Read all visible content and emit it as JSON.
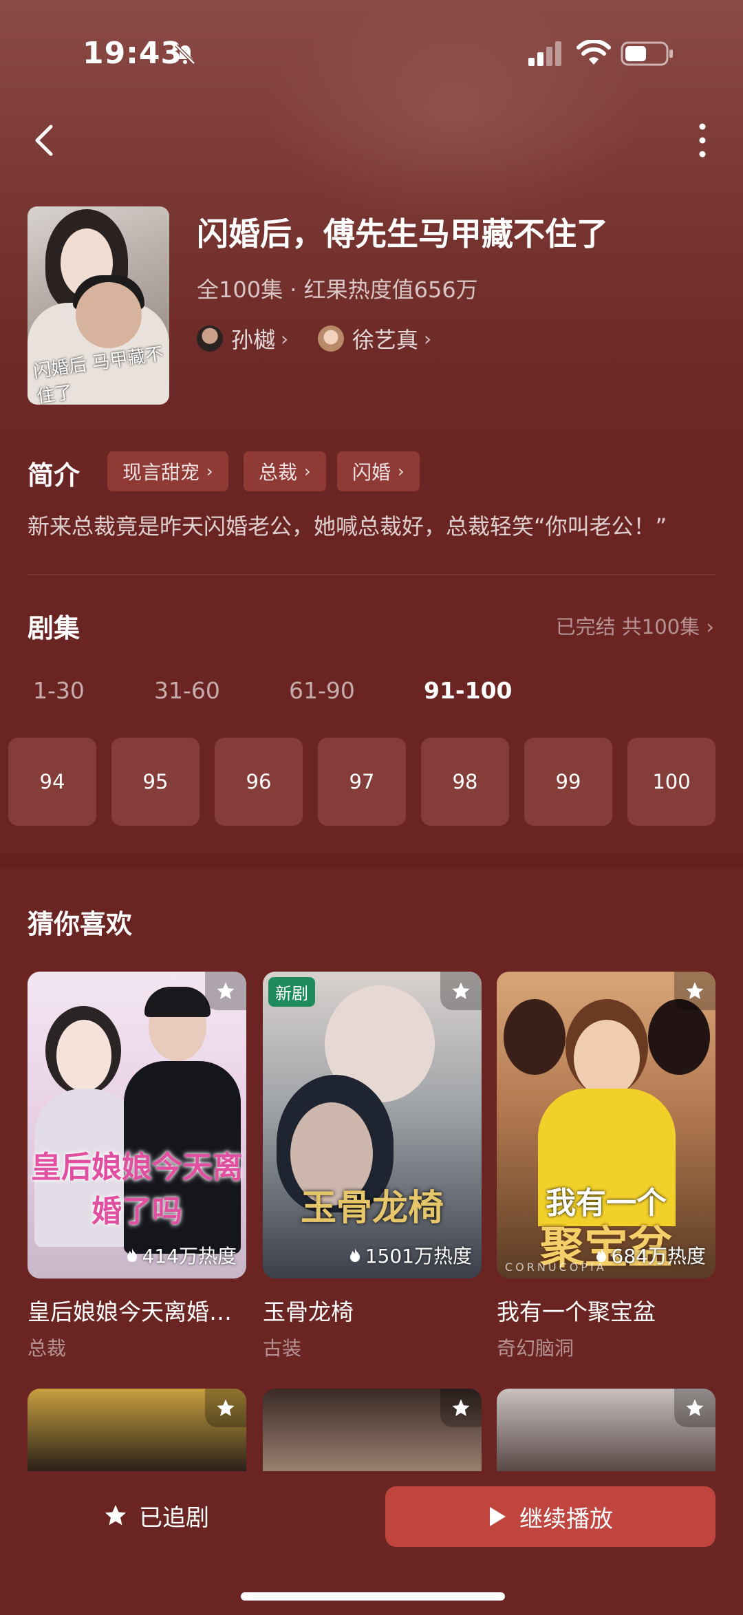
{
  "status_bar": {
    "time": "19:43"
  },
  "drama": {
    "title": "闪婚后，傅先生马甲藏不住了",
    "meta": "全100集 · 红果热度值656万",
    "cover_text": "闪婚后 马甲藏不住了",
    "actors": [
      {
        "name": "孙樾"
      },
      {
        "name": "徐艺真"
      }
    ]
  },
  "synopsis": {
    "heading": "简介",
    "tags": [
      "现言甜宠",
      "总裁",
      "闪婚"
    ],
    "text": "新来总裁竟是昨天闪婚老公，她喊总裁好，总裁轻笑“你叫老公！”"
  },
  "episodes": {
    "heading": "剧集",
    "status": "已完结 共100集",
    "ranges": [
      "1-30",
      "31-60",
      "61-90",
      "91-100"
    ],
    "active_range": "91-100",
    "numbers": [
      "94",
      "95",
      "96",
      "97",
      "98",
      "99",
      "100"
    ]
  },
  "recommend": {
    "heading": "猜你喜欢",
    "items": [
      {
        "title": "皇后娘娘今天离婚…",
        "genre": "总裁",
        "heat": "414万热度",
        "art": "皇后娘娘今天离婚了吗"
      },
      {
        "title": "玉骨龙椅",
        "genre": "古装",
        "heat": "1501万热度",
        "badge": "新剧",
        "art": "玉骨龙椅"
      },
      {
        "title": "我有一个聚宝盆",
        "genre": "奇幻脑洞",
        "heat": "684万热度",
        "art_line1": "我有一个",
        "art_line2": "聚宝盆",
        "art_sub": "CORNUCOPIA"
      }
    ]
  },
  "bottom": {
    "follow_label": "已追剧",
    "play_label": "继续播放"
  },
  "colors": {
    "background": "#6a2523",
    "tag_bg": "#8f3a35",
    "episode_btn": "#853d39",
    "play_btn": "#c0453e",
    "new_badge": "#1f8a5c"
  }
}
